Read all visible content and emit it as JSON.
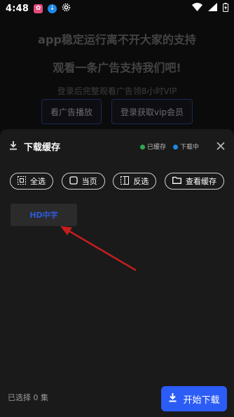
{
  "status_bar": {
    "time": "4:48"
  },
  "promo": {
    "line1": "app稳定运行离不开大家的支持",
    "line2": "观看一条广告支持我们吧!",
    "line3": "登录后完整观看广告领8小时VIP",
    "watch_ad_label": "看广告播放",
    "login_vip_label": "登录获取vip会员"
  },
  "sheet": {
    "title": "下载缓存",
    "legend": {
      "cached_label": "已缓存",
      "cached_color": "#2ea84f",
      "downloading_label": "下载中",
      "downloading_color": "#1e88e5"
    },
    "actions": [
      {
        "label": "全选",
        "icon": "select-all-icon"
      },
      {
        "label": "当页",
        "icon": "square-icon"
      },
      {
        "label": "反选",
        "icon": "invert-selection-icon"
      },
      {
        "label": "查看缓存",
        "icon": "folder-icon"
      }
    ],
    "episode_label": "HD中字",
    "selected_text": "已选择 0 集",
    "start_download_label": "开始下载"
  },
  "colors": {
    "accent": "#2c5cf6",
    "annotation_arrow": "#c41e1e"
  }
}
